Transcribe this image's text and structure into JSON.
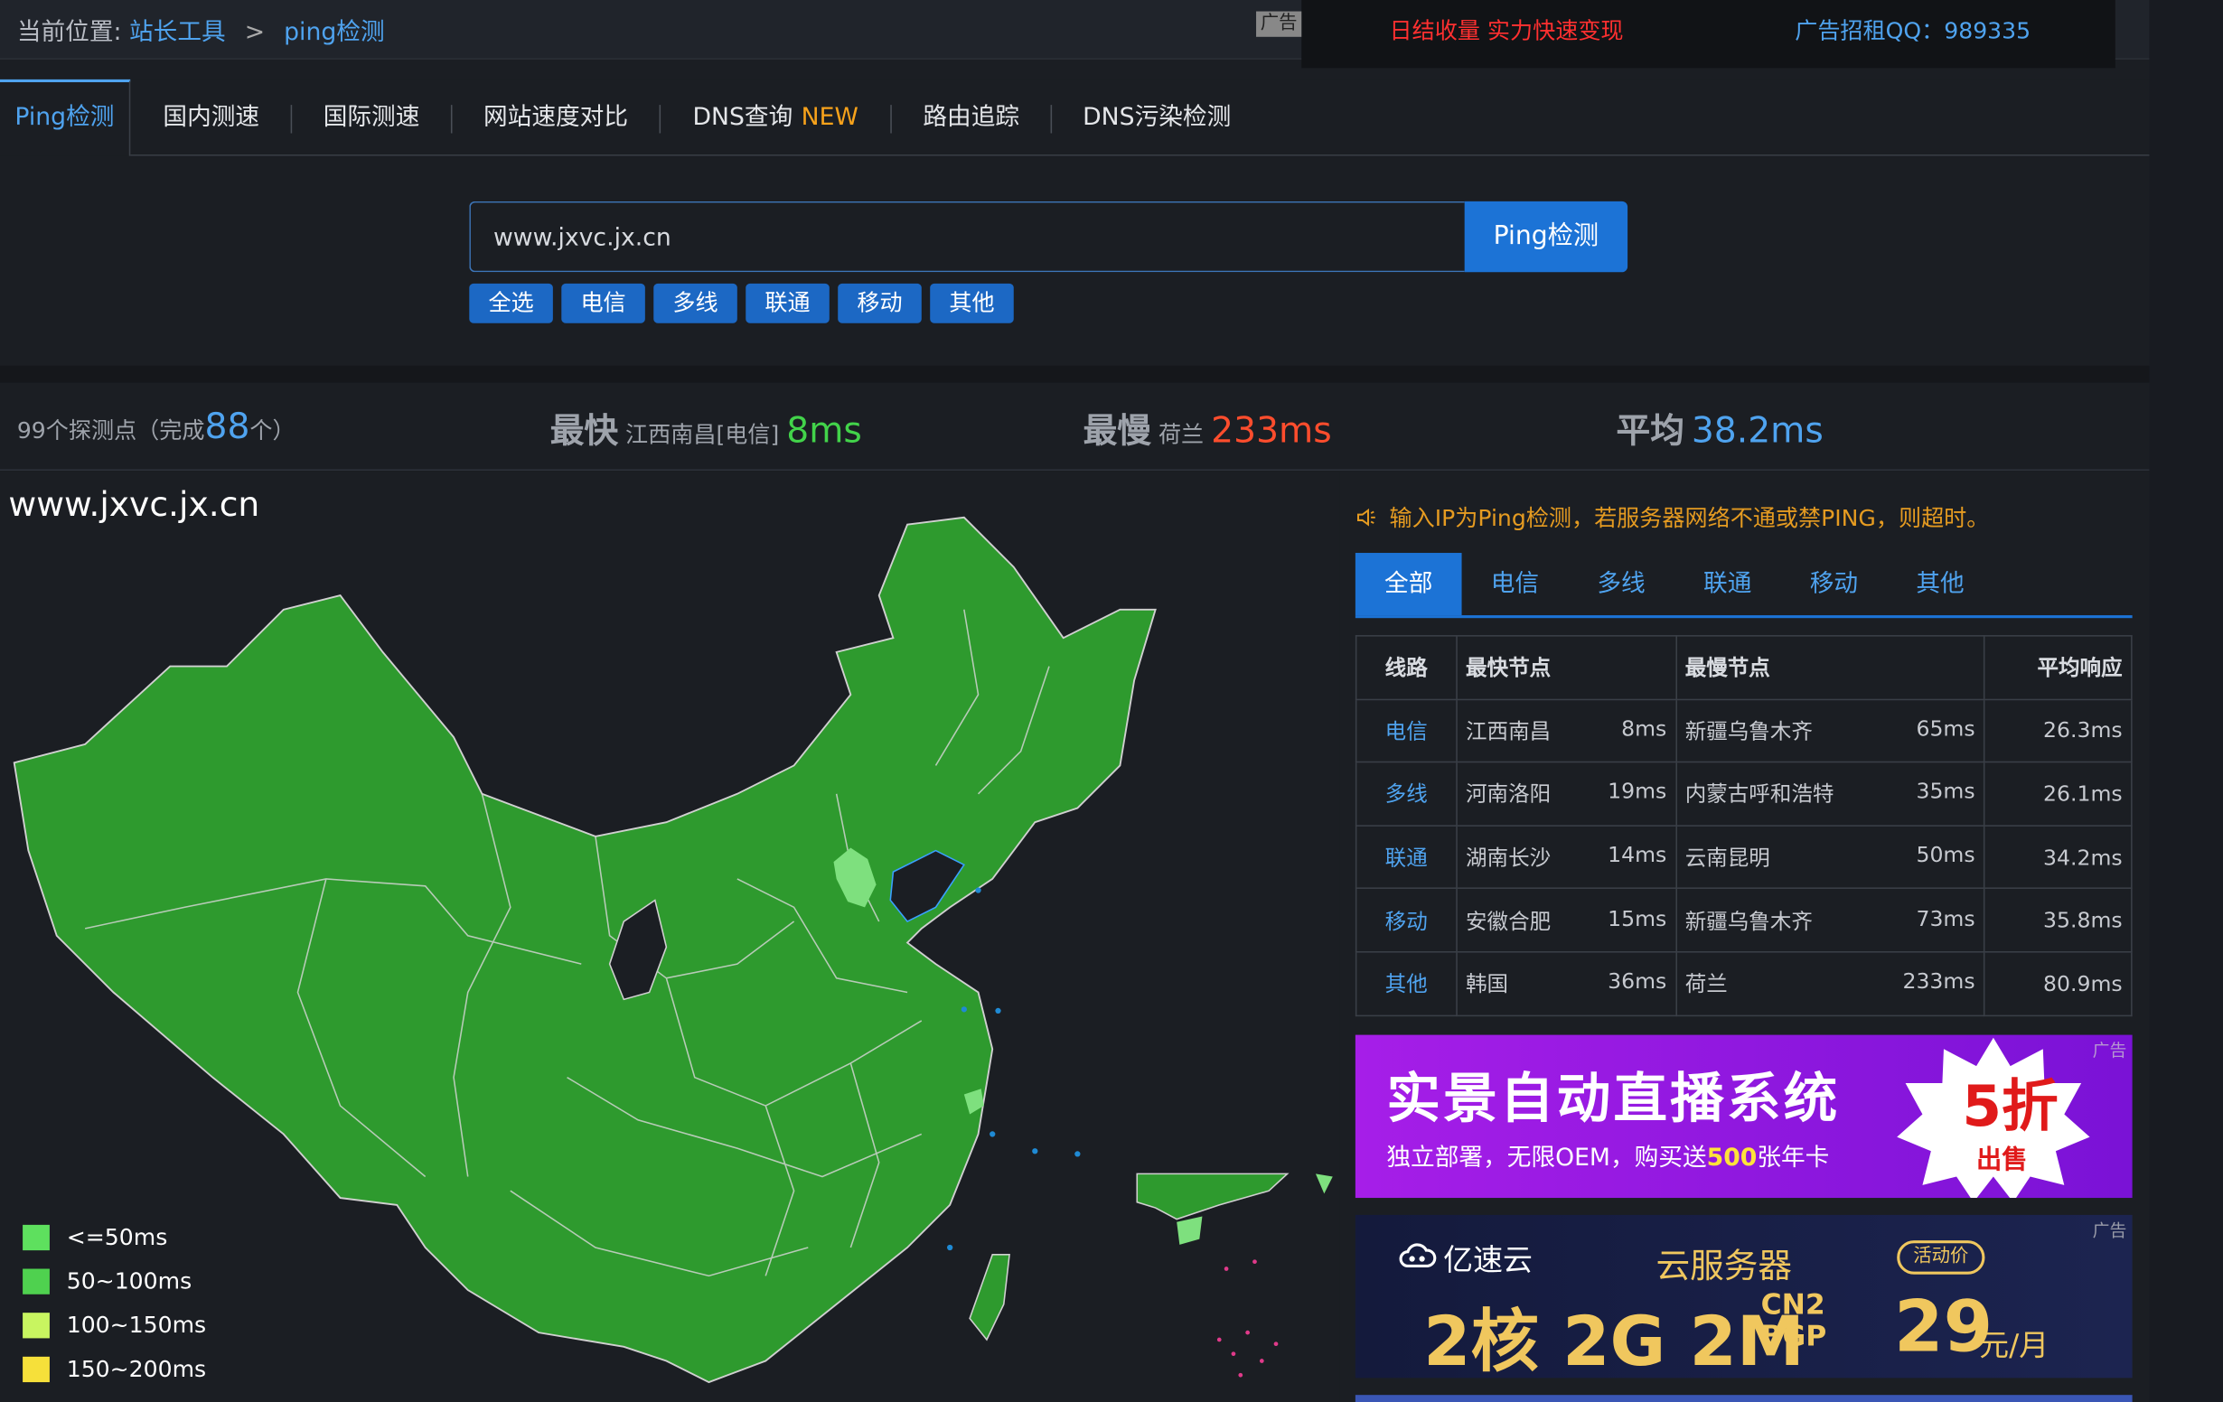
{
  "breadcrumb": {
    "label": "当前位置:",
    "item1": "站长工具",
    "sep": ">",
    "item2": "ping检测"
  },
  "top_ad": {
    "tag": "广告",
    "text1": "日结收量 实力快速变现",
    "text2": "广告招租QQ：989335"
  },
  "tabs": [
    {
      "label": "Ping检测"
    },
    {
      "label": "国内测速"
    },
    {
      "label": "国际测速"
    },
    {
      "label": "网站速度对比"
    },
    {
      "label": "DNS查询",
      "badge": "NEW"
    },
    {
      "label": "路由追踪"
    },
    {
      "label": "DNS污染检测"
    }
  ],
  "search": {
    "value": "www.jxvc.jx.cn",
    "button": "Ping检测"
  },
  "chips": [
    "全选",
    "电信",
    "多线",
    "联通",
    "移动",
    "其他"
  ],
  "stats": {
    "prefix": "99个探测点（完成",
    "done": "88",
    "suffix": "个）",
    "fast_label": "最快",
    "fast_loc": "江西南昌[电信]",
    "fast_val": "8ms",
    "slow_label": "最慢",
    "slow_loc": "荷兰",
    "slow_val": "233ms",
    "avg_label": "平均",
    "avg_val": "38.2ms"
  },
  "map": {
    "title": "www.jxvc.jx.cn",
    "legend": [
      {
        "label": "<=50ms",
        "color": "#5ee05e"
      },
      {
        "label": "50~100ms",
        "color": "#4fd14f"
      },
      {
        "label": "100~150ms",
        "color": "#c8f560"
      },
      {
        "label": "150~200ms",
        "color": "#f6e03a"
      }
    ]
  },
  "notice": "输入IP为Ping检测，若服务器网络不通或禁PING，则超时。",
  "rtabs": [
    "全部",
    "电信",
    "多线",
    "联通",
    "移动",
    "其他"
  ],
  "table": {
    "headers": [
      "线路",
      "最快节点",
      "最慢节点",
      "平均响应"
    ],
    "rows": [
      {
        "line": "电信",
        "fast": "江西南昌",
        "fast_ms": "8ms",
        "slow": "新疆乌鲁木齐",
        "slow_ms": "65ms",
        "avg": "26.3ms"
      },
      {
        "line": "多线",
        "fast": "河南洛阳",
        "fast_ms": "19ms",
        "slow": "内蒙古呼和浩特",
        "slow_ms": "35ms",
        "avg": "26.1ms"
      },
      {
        "line": "联通",
        "fast": "湖南长沙",
        "fast_ms": "14ms",
        "slow": "云南昆明",
        "slow_ms": "50ms",
        "avg": "34.2ms"
      },
      {
        "line": "移动",
        "fast": "安徽合肥",
        "fast_ms": "15ms",
        "slow": "新疆乌鲁木齐",
        "slow_ms": "73ms",
        "avg": "35.8ms"
      },
      {
        "line": "其他",
        "fast": "韩国",
        "fast_ms": "36ms",
        "slow": "荷兰",
        "slow_ms": "233ms",
        "avg": "80.9ms"
      }
    ]
  },
  "banner1": {
    "title": "实景自动直播系统",
    "sub_a": "独立部署，无限OEM，购买送",
    "sub_hl": "500",
    "sub_b": "张年卡",
    "badge": "5折",
    "badge_sub": "出售",
    "ad": "广告"
  },
  "banner2": {
    "logo": "亿速云",
    "title": "云服务器",
    "tag": "活动价",
    "spec": "2核 2G 2M",
    "cn2": "CN2",
    "bgp": "BGP",
    "price": "29",
    "unit": "元/月",
    "ad": "广告"
  },
  "colors": {
    "accent": "#1c73d6",
    "link": "#4fa3ef",
    "fast": "#42d34a",
    "slow": "#ff4d2d",
    "map_fill": "#2e9a2e"
  }
}
